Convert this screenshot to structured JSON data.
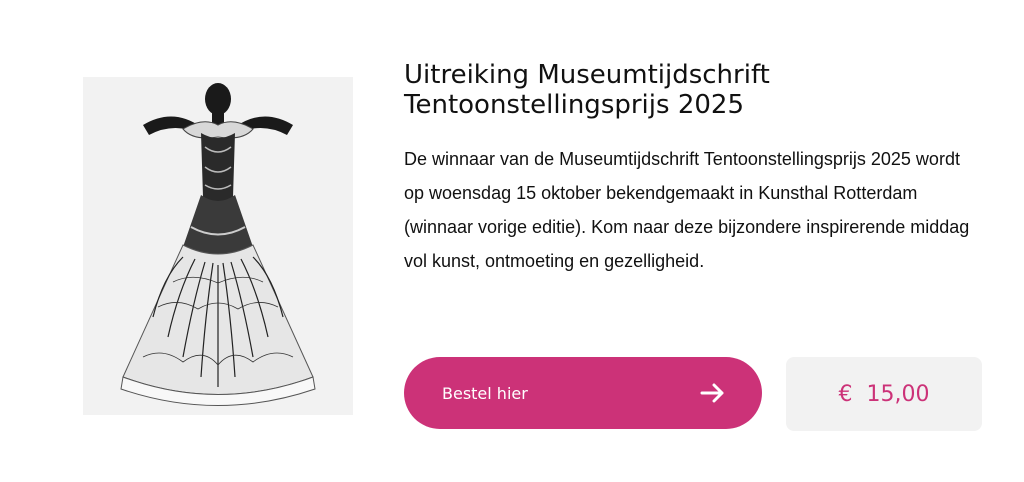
{
  "event": {
    "title": "Uitreiking Museumtijdschrift Tentoonstellingsprijs 2025",
    "description": "De winnaar van de Museumtijdschrift Tentoonstellingsprijs 2025 wordt op woensdag 15 oktober bekendgemaakt in Kunsthal Rotterdam (winnaar vorige editie). Kom naar deze bijzondere inspirerende middag vol kunst, ontmoeting en gezelligheid.",
    "image_icon": "fashion-photo"
  },
  "order": {
    "button_label": "Bestel hier",
    "arrow_icon": "arrow-right-icon",
    "price": "€  15,00"
  },
  "colors": {
    "accent": "#cc3278",
    "price_bg": "#f2f2f2"
  }
}
